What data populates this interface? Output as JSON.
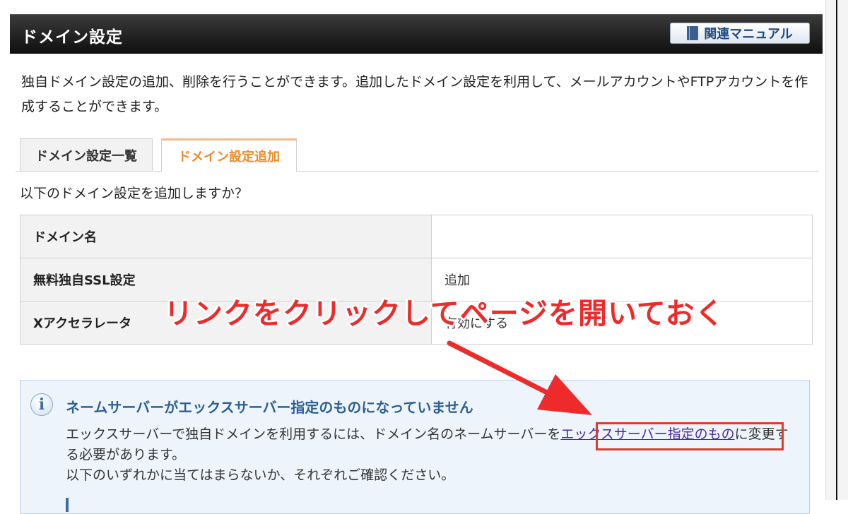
{
  "header": {
    "title": "ドメイン設定",
    "manual_button_label": "関連マニュアル"
  },
  "intro_text": "独自ドメイン設定の追加、削除を行うことができます。追加したドメイン設定を利用して、メールアカウントやFTPアカウントを作成することができます。",
  "tabs": [
    {
      "label": "ドメイン設定一覧",
      "active": false
    },
    {
      "label": "ドメイン設定追加",
      "active": true
    }
  ],
  "confirm_text": "以下のドメイン設定を追加しますか？",
  "settings": {
    "rows": [
      {
        "label": "ドメイン名",
        "value": ""
      },
      {
        "label": "無料独自SSL設定",
        "value": "追加"
      },
      {
        "label": "Xアクセラレータ",
        "value": "有効にする"
      }
    ]
  },
  "notice": {
    "title": "ネームサーバーがエックスサーバー指定のものになっていません",
    "body_before_link": "エックスサーバーで独自ドメインを利用するには、ドメイン名のネームサーバーを",
    "link_text": "エックスサーバー指定のもの",
    "body_after_link": "に変更する必要があります。",
    "body_line2": "以下のいずれかに当てはまらないか、それぞれご確認ください。"
  },
  "annotation": {
    "text": "リンクをクリックしてページを開いておく",
    "color": "#ef2a2a"
  },
  "colors": {
    "header_bg": "#1a1a1a",
    "active_tab_text": "#ee8a2a",
    "notice_title": "#2d5f95",
    "link": "#4a2aa0"
  }
}
